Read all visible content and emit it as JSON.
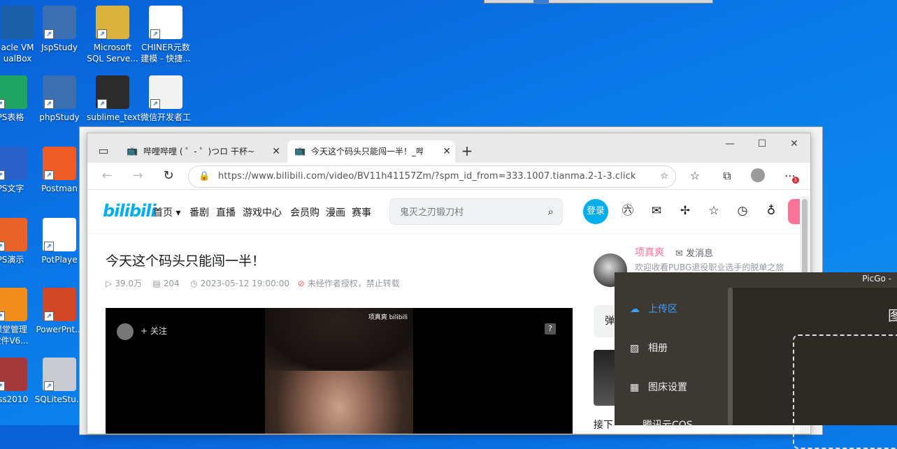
{
  "desktop": {
    "icons": [
      {
        "label": "acle VM\nualBox",
        "color": "#1b5fa8"
      },
      {
        "label": "JspStudy",
        "color": "#3c6fb0"
      },
      {
        "label": "Microsoft\nSQL Serve...",
        "color": "#d8b23a"
      },
      {
        "label": "CHINER元数\n建模 - 快捷...",
        "color": "#ffffff"
      },
      {
        "label": "PS表格",
        "color": "#1fa463"
      },
      {
        "label": "phpStudy",
        "color": "#3c6fb0"
      },
      {
        "label": "sublime_text",
        "color": "#2b2b2b"
      },
      {
        "label": "微信开发者工",
        "color": "#f2f2f2"
      },
      {
        "label": "PS文字",
        "color": "#2a62c9"
      },
      {
        "label": "Postman",
        "color": "#ef5b25"
      },
      {
        "label": "PS演示",
        "color": "#e8622a"
      },
      {
        "label": "PotPlaye",
        "color": "#ffffff"
      },
      {
        "label": "课堂管理\n软件V6...",
        "color": "#f18d1d"
      },
      {
        "label": "PowerPnt...",
        "color": "#d24726"
      },
      {
        "label": "ess2010",
        "color": "#a4373a"
      },
      {
        "label": "SQLiteStu...",
        "color": "#c8ccd2"
      }
    ]
  },
  "browser": {
    "tabs": [
      {
        "title": "哔哩哔哩 ( ゜- ゜)つロ 干杯~-bilil",
        "active": false
      },
      {
        "title": "今天这个码头只能闯一半！_哔哩",
        "active": true
      }
    ],
    "new_tab": "+",
    "url": "https://www.bilibili.com/video/BV11h41157Zm/?spm_id_from=333.1007.tianma.2-1-3.click",
    "badge": "1"
  },
  "bili": {
    "logo": "bilibili",
    "nav": [
      "首页",
      "番剧",
      "直播",
      "游戏中心",
      "会员购",
      "漫画",
      "赛事"
    ],
    "search_placeholder": "鬼灭之刃锻刀村",
    "login": "登录",
    "video": {
      "title": "今天这个码头只能闯一半！",
      "views": "39.0万",
      "danmaku": "204",
      "date": "2023-05-12 19:00:00",
      "copyright": "未经作者授权，禁止转载"
    },
    "player": {
      "follow": "关注",
      "watermark": "项真爽 bilibili"
    },
    "uploader": {
      "name": "项真爽",
      "message": "发消息",
      "desc": "欢迎收看PUBG退役职业选手的脱单之旅"
    },
    "danmu_label": "弹",
    "next_label": "接下"
  },
  "picgo": {
    "title": "PicGo -",
    "menu": [
      "上传区",
      "相册",
      "图床设置",
      "腾讯云COS"
    ],
    "main_label": "图"
  }
}
